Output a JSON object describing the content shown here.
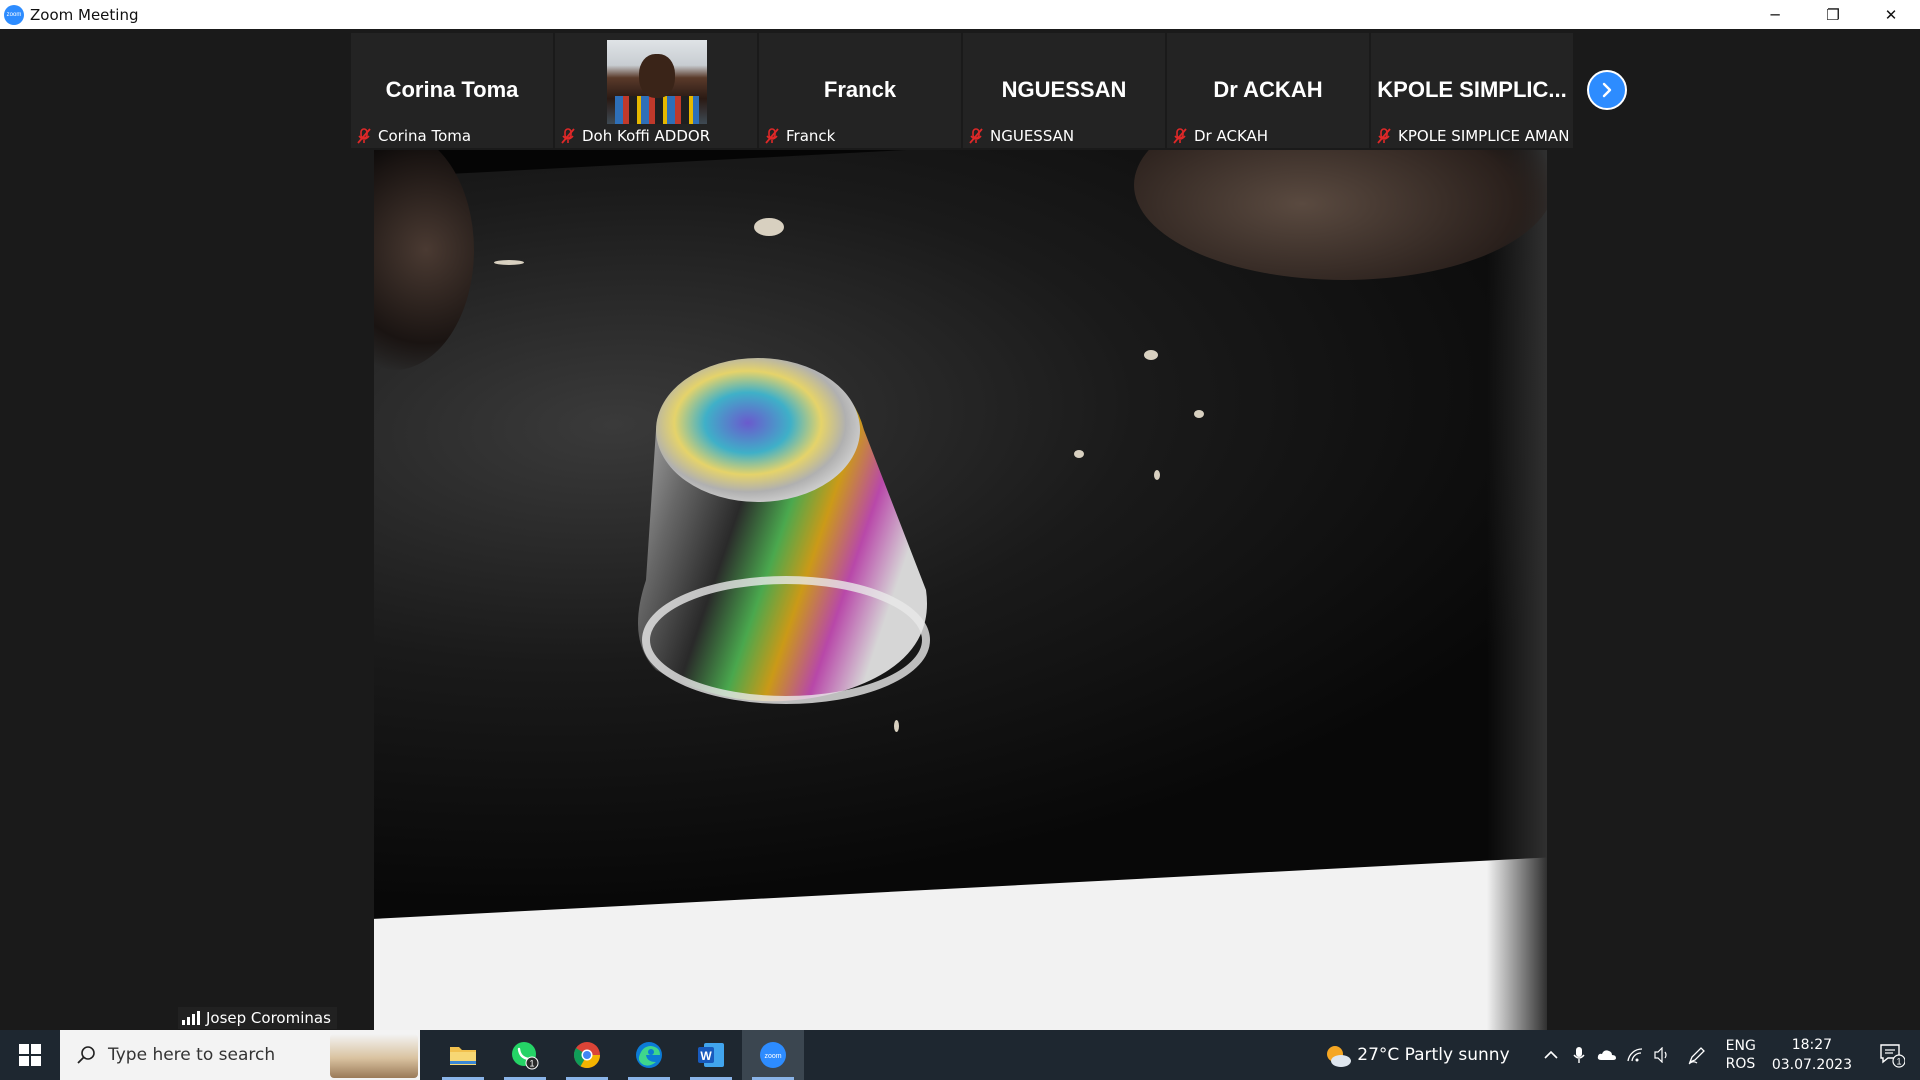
{
  "window": {
    "title": "Zoom Meeting",
    "logo_text": "zoom",
    "minimize": "─",
    "restore": "❐",
    "close": "✕"
  },
  "participants": [
    {
      "display_name": "Corina Toma",
      "label": "Corina Toma",
      "muted": true,
      "has_video": false
    },
    {
      "display_name": "",
      "label": "Doh Koffi ADDOR",
      "muted": true,
      "has_video": true
    },
    {
      "display_name": "Franck",
      "label": "Franck",
      "muted": true,
      "has_video": false
    },
    {
      "display_name": "NGUESSAN",
      "label": "NGUESSAN",
      "muted": true,
      "has_video": false
    },
    {
      "display_name": "Dr ACKAH",
      "label": "Dr ACKAH",
      "muted": true,
      "has_video": false
    },
    {
      "display_name": "KPOLE  SIMPLIC...",
      "label": "KPOLE SIMPLICE AMAN",
      "muted": true,
      "has_video": false
    }
  ],
  "active_speaker": {
    "name": "Josep Corominas"
  },
  "taskbar": {
    "search_placeholder": "Type here to search",
    "whatsapp_badge": "1",
    "word_letter": "W",
    "zoom_text": "zoom",
    "weather": "27°C  Partly sunny",
    "language_top": "ENG",
    "language_bottom": "ROS",
    "time": "18:27",
    "date": "03.07.2023",
    "notification_count": "1"
  },
  "colors": {
    "zoom_blue": "#2d8cff",
    "muted_red": "#e02828",
    "taskbar_bg": "#1e2730"
  }
}
